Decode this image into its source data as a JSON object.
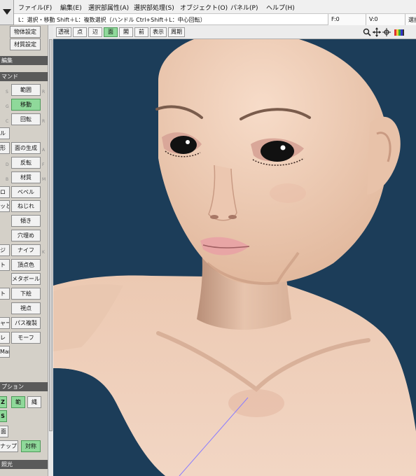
{
  "menubar": {
    "items": [
      "ファイル(F)",
      "編集(E)",
      "選択部属性(A)",
      "選択部処理(S)",
      "オブジェクト(O)",
      "パネル(P)",
      "ヘルプ(H)"
    ]
  },
  "hintbar": {
    "text": "L：選択・移動  Shift＋L：複数選択（ハンドル  Ctrl+Shift＋L：中心回転）",
    "f_label": "F:0",
    "v_label": "V:0",
    "right_label": "選択"
  },
  "viewbar": {
    "buttons": [
      "透視",
      "点",
      "辺",
      "面",
      "閣",
      "前",
      "表示",
      "周期"
    ],
    "active_button": "面",
    "tool_icons": [
      "search-icon",
      "move-icon",
      "rotate-icon",
      "color-icon"
    ]
  },
  "left_panel": {
    "top_buttons": [
      "物体設定",
      "材質設定"
    ],
    "section_edit": "編集",
    "section_command": "マンド",
    "commands": [
      {
        "left": "",
        "right": "範囲",
        "right_key": "R",
        "left_key": "S"
      },
      {
        "left": "",
        "right": "移動",
        "right_key": "",
        "left_key": "G",
        "active": true
      },
      {
        "left": "",
        "right": "回転",
        "right_key": "R",
        "left_key": "C"
      },
      {
        "left": "ル",
        "right": "",
        "right_key": "",
        "left_key": ""
      },
      {
        "left": "形",
        "right": "面の生成",
        "right_key": "A",
        "left_key": ""
      },
      {
        "left": "",
        "right": "反転",
        "right_key": "F",
        "left_key": "D"
      },
      {
        "left": "",
        "right": "材質",
        "right_key": "M",
        "left_key": "B"
      },
      {
        "left": "ロ",
        "right": "ベベル",
        "right_key": "",
        "left_key": ""
      },
      {
        "left": "ッと",
        "right": "ねじれ",
        "right_key": "",
        "left_key": ""
      },
      {
        "left": "",
        "right": "傾き",
        "right_key": "",
        "left_key": ""
      },
      {
        "left": "",
        "right": "穴埋め",
        "right_key": "",
        "left_key": ""
      },
      {
        "left": "ジ",
        "right": "ナイフ",
        "right_key": "K",
        "left_key": ""
      },
      {
        "left": "ト",
        "right": "頂点色",
        "right_key": "",
        "left_key": ""
      },
      {
        "left": "",
        "right": "メタボール",
        "right_key": "",
        "left_key": ""
      },
      {
        "left": "ト",
        "right": "下絵",
        "right_key": "",
        "left_key": ""
      },
      {
        "left": "",
        "right": "視点",
        "right_key": "",
        "left_key": ""
      },
      {
        "left": "ャー",
        "right": "パス複製",
        "right_key": "",
        "left_key": ""
      },
      {
        "left": "レ",
        "right": "モーフ",
        "right_key": "",
        "left_key": ""
      },
      {
        "left": "Man",
        "right": "",
        "right_key": "",
        "left_key": ""
      }
    ],
    "section_option": "プション",
    "option_buttons": [
      "Z",
      "範",
      "縄",
      "S",
      "面",
      "ナップ",
      "対称"
    ],
    "section_light": "照光"
  },
  "colors": {
    "viewport_bg": "#1c3d59",
    "active_green": "#8fd99a",
    "skin": "#efcfb8"
  }
}
